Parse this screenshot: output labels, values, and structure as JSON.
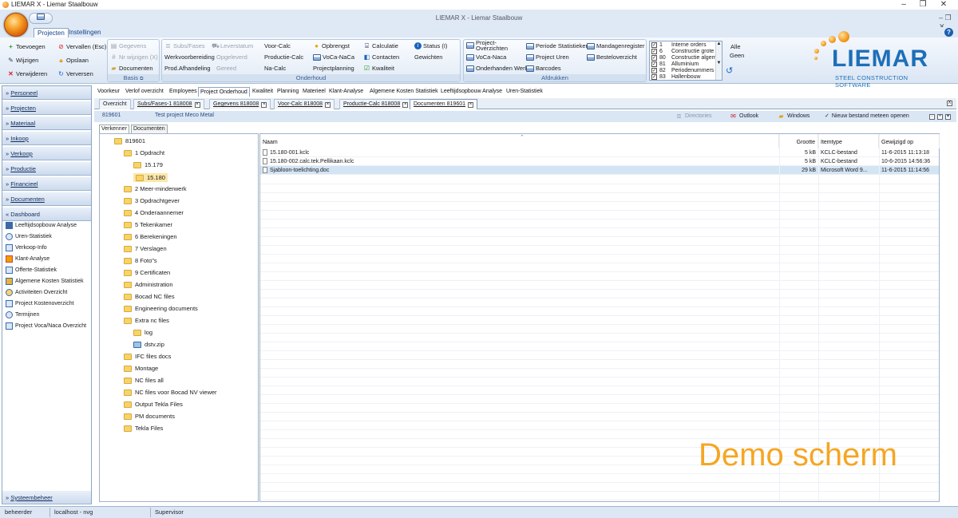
{
  "window": {
    "title": "LIEMAR X - Liemar Staalbouw",
    "caption": "LIEMAR X - Liemar Staalbouw"
  },
  "ribbon_tabs": [
    "Projecten",
    "Instellingen"
  ],
  "ribbon": {
    "g1": {
      "add": "Toevoegen",
      "cancel": "Vervallen (Esc)",
      "edit": "Wijzigen",
      "save": "Opslaan",
      "delete": "Verwijderen",
      "refresh": "Verversen"
    },
    "basis": {
      "label": "Basis",
      "gegevens": "Gegevens",
      "nr": "Nr wijzigen (X)",
      "documenten": "Documenten"
    },
    "onderhoud": {
      "label": "Onderhoud",
      "subs": "Subs/Fases",
      "leverstatum": "Leverstatum",
      "werkvoorbereiding": "Werkvoorbereiding",
      "opgeleverd": "Opgeleverd",
      "prodafh": "Prod.Afhandeling",
      "gereed": "Gereed",
      "voorcalc": "Voor-Calc",
      "productiecalc": "Productie-Calc",
      "nacalc": "Na-Calc",
      "opbrengst": "Opbrengst",
      "voca": "VoCa-NaCa",
      "projectplanning": "Projectplanning",
      "calculatie": "Calculatie",
      "contacten": "Contacten",
      "kwaliteit": "Kwaliteit",
      "status": "Status (I)",
      "gewichten": "Gewichten"
    },
    "afdrukken": {
      "label": "Afdrukken",
      "projoverz": "Project-\nOverzichten",
      "voca": "VoCa-Naca",
      "onderhanden": "Onderhanden Werk",
      "periode": "Periode Statistieken",
      "uren": "Project Uren",
      "barcodes": "Barcodes",
      "mandagen": "Mandagenregister",
      "bestel": "Besteloverzicht"
    },
    "typelist": [
      {
        "num": "1",
        "label": "Interne orders"
      },
      {
        "num": "6",
        "label": "Constructie grote p"
      },
      {
        "num": "80",
        "label": "Constructie algem"
      },
      {
        "num": "81",
        "label": "Alluminium"
      },
      {
        "num": "82",
        "label": "Periodenummers c"
      },
      {
        "num": "83",
        "label": "Hallenbouw"
      }
    ],
    "alle": "Alle",
    "geen": "Geen"
  },
  "logo": {
    "name": "LIEMAR",
    "tagline": "STEEL CONSTRUCTION SOFTWARE"
  },
  "leftnav": {
    "sections": [
      "Personeel",
      "Projecten",
      "Materiaal",
      "Inkoop",
      "Verkoop",
      "Productie",
      "Financieel",
      "Documenten",
      "Dashboard"
    ],
    "dashboard_items": [
      "Leeftijdsopbouw Analyse",
      "Uren-Statistiek",
      "Verkoop-Info",
      "Klant-Analyse",
      "Offerte-Statistiek",
      "Algemene Kosten Statistiek",
      "Activiteiten Overzicht",
      "Project Kostenoverzicht",
      "Termijnen",
      "Project Voca/Naca Overzicht"
    ],
    "bottom": "Systeembeheer"
  },
  "doctabs": [
    "Voorkeur",
    "Verlof overzicht",
    "Employees",
    "Project Onderhoud",
    "Kwaliteit",
    "Planning",
    "Materieel",
    "Klant-Analyse",
    "Algemene Kosten Statistiek",
    "Leeftijdsopbouw Analyse",
    "Uren-Statistiek"
  ],
  "subtabs": [
    "Overzicht",
    "Subs/Fases-1 818008",
    "Gegevens 818008",
    "Voor-Calc 818008",
    "Productie-Calc 818008",
    "Documenten 819601"
  ],
  "infobar": {
    "project_nr": "819601",
    "project_name": "Test project Meco Metal",
    "directories": "Directories",
    "outlook": "Outlook",
    "windows": "Windows",
    "open_new": "Nieuw bestand meteen openen",
    "close": "X"
  },
  "viewtabs": [
    "Verkenner",
    "Documenten"
  ],
  "tree": [
    {
      "label": "819601",
      "level": 0
    },
    {
      "label": "1 Opdracht",
      "level": 1
    },
    {
      "label": "15.179",
      "level": 2
    },
    {
      "label": "15.180",
      "level": 2,
      "selected": true
    },
    {
      "label": "2 Meer-minderwerk",
      "level": 1
    },
    {
      "label": "3 Opdrachtgever",
      "level": 1
    },
    {
      "label": "4 Onderaannemer",
      "level": 1
    },
    {
      "label": "5 Tekenkamer",
      "level": 1
    },
    {
      "label": "6 Berekeningen",
      "level": 1
    },
    {
      "label": "7 Verslagen",
      "level": 1
    },
    {
      "label": "8 Foto\"s",
      "level": 1
    },
    {
      "label": "9 Certificaten",
      "level": 1
    },
    {
      "label": "Administration",
      "level": 1
    },
    {
      "label": "Bocad NC files",
      "level": 1
    },
    {
      "label": "Engineering documents",
      "level": 1
    },
    {
      "label": "Extra nc files",
      "level": 1
    },
    {
      "label": "log",
      "level": 2
    },
    {
      "label": "dstv.zip",
      "level": 2,
      "zip": true
    },
    {
      "label": "IFC files docs",
      "level": 1
    },
    {
      "label": "Montage",
      "level": 1
    },
    {
      "label": "NC files all",
      "level": 1
    },
    {
      "label": "NC files voor Bocad NV viewer",
      "level": 1
    },
    {
      "label": "Output Tekla Files",
      "level": 1
    },
    {
      "label": "PM documents",
      "level": 1
    },
    {
      "label": "Tekla Files",
      "level": 1
    }
  ],
  "files": {
    "headers": {
      "name": "Naam",
      "size": "Grootte",
      "type": "Itemtype",
      "modified": "Gewijzigd op"
    },
    "rows": [
      {
        "name": "15.180-001.kclc",
        "size": "5 kB",
        "type": "KCLC-bestand",
        "modified": "11-6-2015 11:13:18"
      },
      {
        "name": "15.180-002.calc.tek.Pellikaan.kclc",
        "size": "5 kB",
        "type": "KCLC-bestand",
        "modified": "10-6-2015 14:56:36"
      },
      {
        "name": "Sjabloon-toelichting.doc",
        "size": "29 kB",
        "type": "Microsoft Word 9...",
        "modified": "11-6-2015 11:14:56",
        "selected": true
      }
    ]
  },
  "watermark": "Demo scherm",
  "status": {
    "user": "beheerder",
    "server": "localhost - nvg",
    "role": "Supervisor"
  },
  "colors": {
    "accent": "#f5a623",
    "ribbon": "#dfe9f5",
    "logo_blue": "#1d6fb8"
  }
}
